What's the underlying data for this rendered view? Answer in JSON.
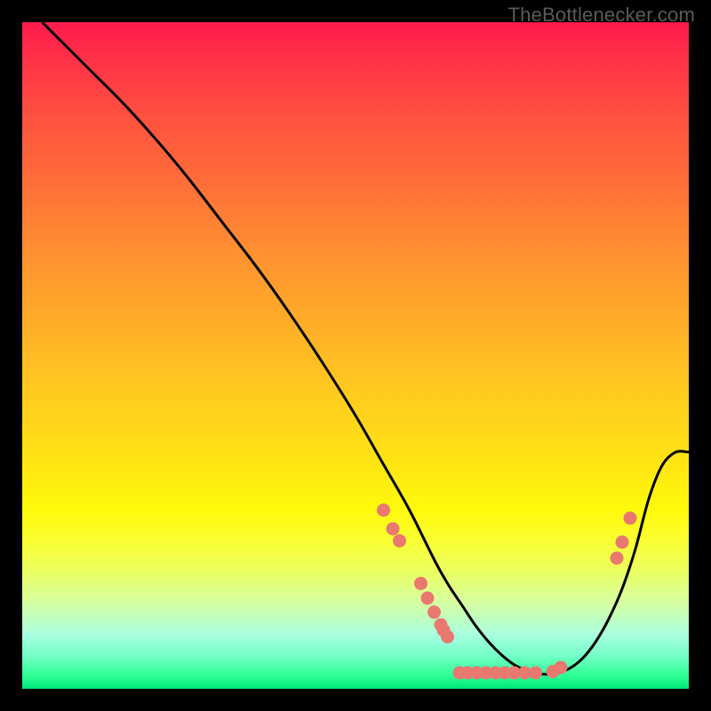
{
  "attribution": "TheBottlenecker.com",
  "colors": {
    "curve": "#000000",
    "marker": "#e9786f",
    "frame_bg_top": "#ff1a4d",
    "frame_bg_bottom": "#00e57a",
    "page_bg": "#000000"
  },
  "chart_data": {
    "type": "line",
    "title": "",
    "xlabel": "",
    "ylabel": "",
    "xlim": [
      0,
      100
    ],
    "ylim": [
      0,
      100
    ],
    "grid": false,
    "legend": false,
    "curve": {
      "name": "bottleneck-curve",
      "x": [
        3,
        6,
        10,
        15,
        20,
        25,
        30,
        35,
        40,
        45,
        50,
        54,
        58,
        62,
        64,
        66,
        68,
        70,
        72,
        74,
        76,
        78,
        80,
        82,
        84,
        86,
        88,
        90,
        92,
        94,
        96,
        98,
        100
      ],
      "y": [
        100,
        97,
        93,
        88,
        82.5,
        76.5,
        70,
        63.5,
        56.5,
        49,
        41,
        34,
        27,
        19,
        15.5,
        12.5,
        9.5,
        7,
        5,
        3.5,
        2.6,
        2.2,
        2.3,
        3,
        4.5,
        7,
        10.5,
        15,
        21,
        28.5,
        33.5,
        35.5,
        35.5
      ]
    },
    "markers": {
      "name": "sample-points",
      "points": [
        {
          "x": 54.2,
          "y": 26.8
        },
        {
          "x": 55.6,
          "y": 24.0
        },
        {
          "x": 56.6,
          "y": 22.2
        },
        {
          "x": 59.8,
          "y": 15.8
        },
        {
          "x": 60.8,
          "y": 13.6
        },
        {
          "x": 61.8,
          "y": 11.5
        },
        {
          "x": 62.8,
          "y": 9.6
        },
        {
          "x": 63.2,
          "y": 8.8
        },
        {
          "x": 63.8,
          "y": 7.8
        },
        {
          "x": 65.6,
          "y": 2.4
        },
        {
          "x": 66.8,
          "y": 2.4
        },
        {
          "x": 68.2,
          "y": 2.4
        },
        {
          "x": 69.6,
          "y": 2.4
        },
        {
          "x": 71.0,
          "y": 2.4
        },
        {
          "x": 72.4,
          "y": 2.4
        },
        {
          "x": 73.8,
          "y": 2.4
        },
        {
          "x": 75.4,
          "y": 2.4
        },
        {
          "x": 77.0,
          "y": 2.4
        },
        {
          "x": 79.6,
          "y": 2.6
        },
        {
          "x": 80.8,
          "y": 3.2
        },
        {
          "x": 89.2,
          "y": 19.6
        },
        {
          "x": 90.0,
          "y": 22.0
        },
        {
          "x": 91.2,
          "y": 25.6
        }
      ]
    }
  }
}
